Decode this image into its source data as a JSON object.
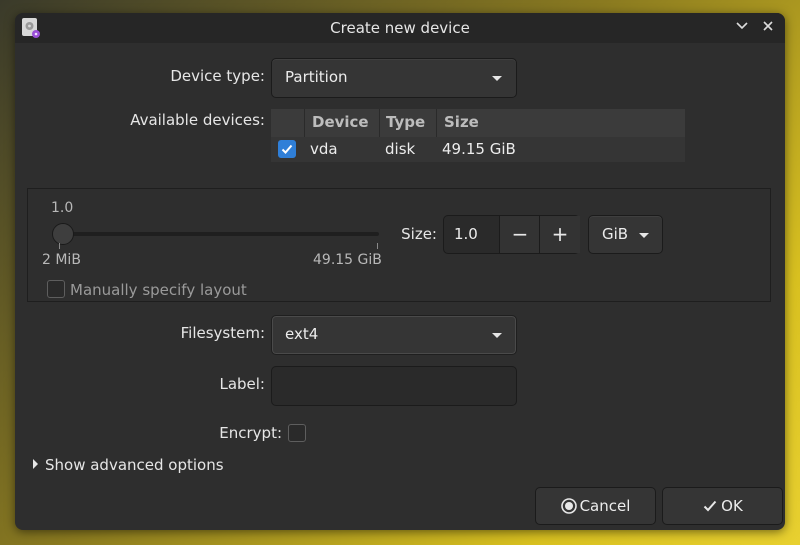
{
  "window": {
    "title": "Create new device",
    "icons": {
      "app": "disk-app-icon",
      "minimize": "chevron-down-icon",
      "close": "close-icon"
    }
  },
  "device_type": {
    "label": "Device type:",
    "value": "Partition"
  },
  "available_devices": {
    "label": "Available devices:",
    "columns": [
      "Device",
      "Type",
      "Size"
    ],
    "rows": [
      {
        "checked": true,
        "device": "vda",
        "type": "disk",
        "size": "49.15 GiB"
      }
    ]
  },
  "size": {
    "slider_value": "1.0",
    "slider_min": "2 MiB",
    "slider_max": "49.15 GiB",
    "label": "Size:",
    "value": "1.0",
    "minus": "−",
    "plus": "+",
    "unit": "GiB",
    "manual_layout_label": "Manually specify layout",
    "manual_layout_checked": false
  },
  "filesystem": {
    "label": "Filesystem:",
    "value": "ext4"
  },
  "label_field": {
    "label": "Label:",
    "value": ""
  },
  "encrypt": {
    "label": "Encrypt:",
    "checked": false
  },
  "advanced": {
    "label": "Show advanced options"
  },
  "buttons": {
    "cancel": "Cancel",
    "ok": "OK"
  },
  "colors": {
    "accent": "#2f7fd8",
    "window_bg": "#2e2e2e"
  }
}
